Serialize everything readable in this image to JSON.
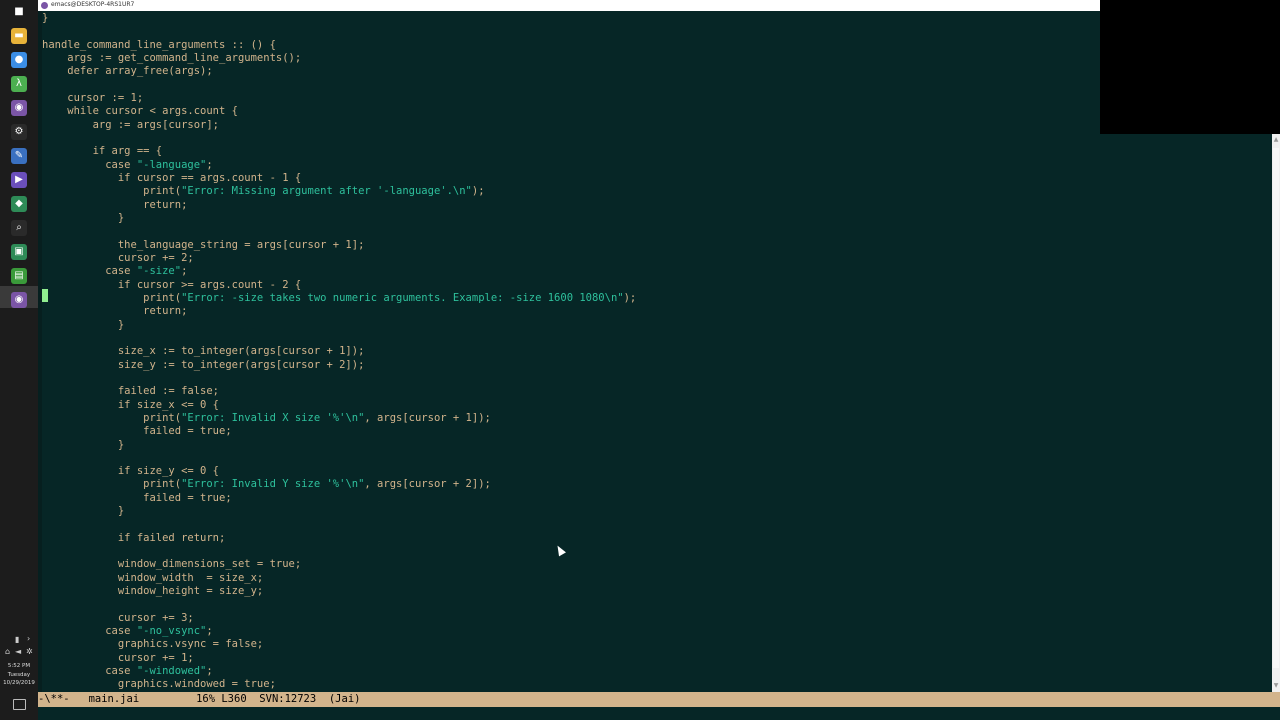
{
  "window": {
    "title": "emacs@DESKTOP-4RS1UR7"
  },
  "taskbar": {
    "items": [
      {
        "icon": "windows-start-icon",
        "glyph": "■",
        "color": "#1c1c1c"
      },
      {
        "icon": "file-explorer-icon",
        "glyph": "▬",
        "color": "#e8b33a"
      },
      {
        "icon": "chrome-icon",
        "glyph": "●",
        "color": "#3b8ee6"
      },
      {
        "icon": "lambda-app-icon",
        "glyph": "λ",
        "color": "#4caf50"
      },
      {
        "icon": "emacs-app-icon",
        "glyph": "◉",
        "color": "#7b55a6"
      },
      {
        "icon": "settings-app-icon",
        "glyph": "⚙",
        "color": "#2a2a2a"
      },
      {
        "icon": "tool-app-icon",
        "glyph": "✎",
        "color": "#3a70c0"
      },
      {
        "icon": "visual-studio-icon",
        "glyph": "▶",
        "color": "#6b4fbb"
      },
      {
        "icon": "green-app-icon",
        "glyph": "◆",
        "color": "#2e8b57"
      },
      {
        "icon": "search-app-icon",
        "glyph": "⌕",
        "color": "#2a2a2a"
      },
      {
        "icon": "terminal-app-icon",
        "glyph": "▣",
        "color": "#2e8b57"
      },
      {
        "icon": "chart-app-icon",
        "glyph": "▤",
        "color": "#3a9a3a"
      },
      {
        "icon": "emacs-active-icon",
        "glyph": "◉",
        "color": "#7b55a6"
      }
    ],
    "clock": {
      "time": "5:52 PM",
      "day": "Tuesday",
      "date": "10/29/2019"
    }
  },
  "editor": {
    "lines": [
      [
        {
          "t": "}"
        }
      ],
      [
        {
          "t": ""
        }
      ],
      [
        {
          "t": "handle_command_line_arguments :: () {"
        }
      ],
      [
        {
          "t": "    args := get_command_line_arguments();"
        }
      ],
      [
        {
          "t": "    defer array_free(args);"
        }
      ],
      [
        {
          "t": ""
        }
      ],
      [
        {
          "t": "    cursor := 1;"
        }
      ],
      [
        {
          "t": "    while cursor < args.count {"
        }
      ],
      [
        {
          "t": "        arg := args[cursor];"
        }
      ],
      [
        {
          "t": ""
        }
      ],
      [
        {
          "t": "        if arg == {"
        }
      ],
      [
        {
          "t": "          case "
        },
        {
          "t": "\"-language\"",
          "s": 1
        },
        {
          "t": ";"
        }
      ],
      [
        {
          "t": "            if cursor == args.count - 1 {"
        }
      ],
      [
        {
          "t": "                print("
        },
        {
          "t": "\"Error: Missing argument after '-language'.\\n\"",
          "s": 1
        },
        {
          "t": ");"
        }
      ],
      [
        {
          "t": "                return;"
        }
      ],
      [
        {
          "t": "            }"
        }
      ],
      [
        {
          "t": ""
        }
      ],
      [
        {
          "t": "            the_language_string = args[cursor + 1];"
        }
      ],
      [
        {
          "t": "            cursor += 2;"
        }
      ],
      [
        {
          "t": "          case "
        },
        {
          "t": "\"-size\"",
          "s": 1
        },
        {
          "t": ";"
        }
      ],
      [
        {
          "t": "            if cursor >= args.count - 2 {"
        }
      ],
      [
        {
          "t": "                print("
        },
        {
          "t": "\"Error: -size takes two numeric arguments. Example: -size 1600 1080\\n\"",
          "s": 1
        },
        {
          "t": ");"
        }
      ],
      [
        {
          "t": "                return;"
        }
      ],
      [
        {
          "t": "            }"
        }
      ],
      [
        {
          "t": ""
        }
      ],
      [
        {
          "t": "            size_x := to_integer(args[cursor + 1]);"
        }
      ],
      [
        {
          "t": "            size_y := to_integer(args[cursor + 2]);"
        }
      ],
      [
        {
          "t": ""
        }
      ],
      [
        {
          "t": "            failed := false;"
        }
      ],
      [
        {
          "t": "            if size_x <= 0 {"
        }
      ],
      [
        {
          "t": "                print("
        },
        {
          "t": "\"Error: Invalid X size '%'\\n\"",
          "s": 1
        },
        {
          "t": ", args[cursor + 1]);"
        }
      ],
      [
        {
          "t": "                failed = true;"
        }
      ],
      [
        {
          "t": "            }"
        }
      ],
      [
        {
          "t": ""
        }
      ],
      [
        {
          "t": "            if size_y <= 0 {"
        }
      ],
      [
        {
          "t": "                print("
        },
        {
          "t": "\"Error: Invalid Y size '%'\\n\"",
          "s": 1
        },
        {
          "t": ", args[cursor + 2]);"
        }
      ],
      [
        {
          "t": "                failed = true;"
        }
      ],
      [
        {
          "t": "            }"
        }
      ],
      [
        {
          "t": ""
        }
      ],
      [
        {
          "t": "            if failed return;"
        }
      ],
      [
        {
          "t": ""
        }
      ],
      [
        {
          "t": "            window_dimensions_set = true;"
        }
      ],
      [
        {
          "t": "            window_width  = size_x;"
        }
      ],
      [
        {
          "t": "            window_height = size_y;"
        }
      ],
      [
        {
          "t": ""
        }
      ],
      [
        {
          "t": "            cursor += 3;"
        }
      ],
      [
        {
          "t": "          case "
        },
        {
          "t": "\"-no_vsync\"",
          "s": 1
        },
        {
          "t": ";"
        }
      ],
      [
        {
          "t": "            graphics.vsync = false;"
        }
      ],
      [
        {
          "t": "            cursor += 1;"
        }
      ],
      [
        {
          "t": "          case "
        },
        {
          "t": "\"-windowed\"",
          "s": 1
        },
        {
          "t": ";"
        }
      ],
      [
        {
          "t": "            graphics.windowed = true;"
        }
      ]
    ]
  },
  "modeline": {
    "status": "-\\**-",
    "buffer": "main.jai",
    "position": "16% L360",
    "svn": "SVN:12723",
    "mode": "(Jai)"
  },
  "colors": {
    "background": "#062626",
    "code": "#d2b48c",
    "string": "#2ec09c",
    "cursor": "#90ee90"
  }
}
